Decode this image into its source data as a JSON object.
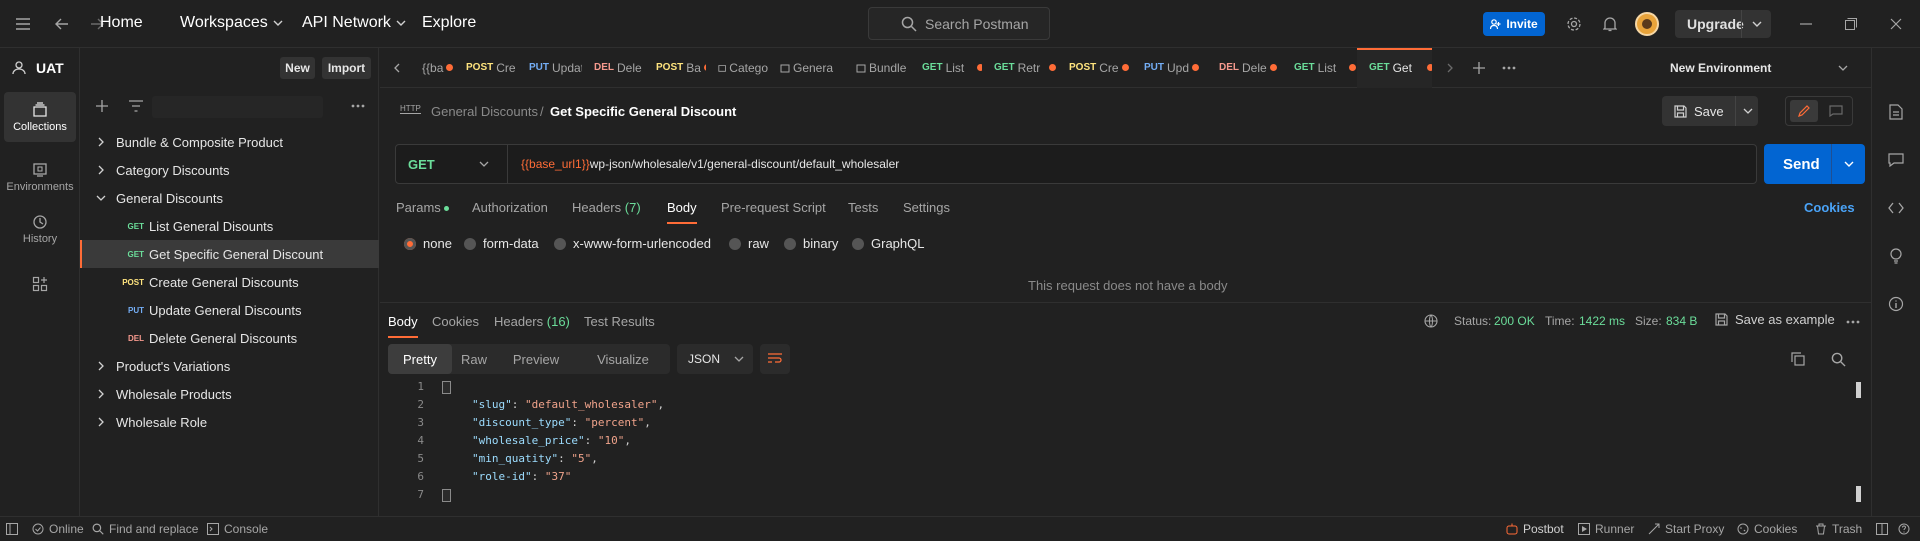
{
  "topbar": {
    "home": "Home",
    "workspaces": "Workspaces",
    "api_network": "API Network",
    "explore": "Explore",
    "search_placeholder": "Search Postman",
    "invite": "Invite",
    "upgrade": "Upgrade"
  },
  "rail": {
    "collections": "Collections",
    "environments": "Environments",
    "history": "History"
  },
  "sidebar": {
    "workspace": "UAT",
    "new": "New",
    "import": "Import",
    "items": [
      {
        "label": "Bundle & Composite Product"
      },
      {
        "label": "Category Discounts"
      },
      {
        "label": "General Discounts"
      },
      {
        "method": "GET",
        "label": "List General Disounts"
      },
      {
        "method": "GET",
        "label": "Get Specific General Discount"
      },
      {
        "method": "POST",
        "label": "Create General Discounts"
      },
      {
        "method": "PUT",
        "label": "Update General Discounts"
      },
      {
        "method": "DEL",
        "label": "Delete General Discounts"
      },
      {
        "label": "Product's Variations"
      },
      {
        "label": "Wholesale Products"
      },
      {
        "label": "Wholesale Role"
      }
    ]
  },
  "tabs": [
    {
      "method": "",
      "label": "{{ba"
    },
    {
      "method": "POST",
      "label": "Cre"
    },
    {
      "method": "PUT",
      "label": "Updat"
    },
    {
      "method": "DEL",
      "label": "Dele"
    },
    {
      "method": "POST",
      "label": "Ba"
    },
    {
      "method": "",
      "label": "Catego"
    },
    {
      "method": "",
      "label": "Genera"
    },
    {
      "method": "",
      "label": "Bundle"
    },
    {
      "method": "GET",
      "label": "List"
    },
    {
      "method": "GET",
      "label": "Retr"
    },
    {
      "method": "POST",
      "label": "Cre"
    },
    {
      "method": "PUT",
      "label": "Upd"
    },
    {
      "method": "DEL",
      "label": "Dele"
    },
    {
      "method": "GET",
      "label": "List"
    },
    {
      "method": "GET",
      "label": "Get"
    }
  ],
  "environment": "New Environment",
  "request": {
    "icon_label": "HTTP",
    "breadcrumb_parent": "General Discounts",
    "breadcrumb_sep": "/",
    "title": "Get Specific General Discount",
    "save": "Save",
    "method": "GET",
    "url_var": "{{base_url1}}",
    "url_path": "wp-json/wholesale/v1/general-discount/default_wholesaler",
    "send": "Send",
    "tabs": {
      "params": "Params",
      "auth": "Authorization",
      "headers": "Headers",
      "headers_count": "(7)",
      "body": "Body",
      "prerequest": "Pre-request Script",
      "tests": "Tests",
      "settings": "Settings",
      "cookies": "Cookies"
    },
    "body_types": [
      "none",
      "form-data",
      "x-www-form-urlencoded",
      "raw",
      "binary",
      "GraphQL"
    ],
    "no_body": "This request does not have a body"
  },
  "response": {
    "tabs": {
      "body": "Body",
      "cookies": "Cookies",
      "headers": "Headers",
      "headers_count": "(16)",
      "tests": "Test Results"
    },
    "status_label": "Status:",
    "status": "200 OK",
    "time_label": "Time:",
    "time": "1422 ms",
    "size_label": "Size:",
    "size": "834 B",
    "save_example": "Save as example",
    "views": {
      "pretty": "Pretty",
      "raw": "Raw",
      "preview": "Preview",
      "visualize": "Visualize"
    },
    "format": "JSON",
    "lines": [
      "1",
      "2",
      "3",
      "4",
      "5",
      "6",
      "7"
    ],
    "body": [
      {
        "key": "\"slug\"",
        "value": "\"default_wholesaler\"",
        "trail": ","
      },
      {
        "key": "\"discount_type\"",
        "value": "\"percent\"",
        "trail": ","
      },
      {
        "key": "\"wholesale_price\"",
        "value": "\"10\"",
        "trail": ","
      },
      {
        "key": "\"min_quatity\"",
        "value": "\"5\"",
        "trail": ","
      },
      {
        "key": "\"role-id\"",
        "value": "\"37\"",
        "trail": ""
      }
    ]
  },
  "statusbar": {
    "online": "Online",
    "find": "Find and replace",
    "console": "Console",
    "postbot": "Postbot",
    "runner": "Runner",
    "proxy": "Start Proxy",
    "cookies": "Cookies",
    "trash": "Trash"
  }
}
